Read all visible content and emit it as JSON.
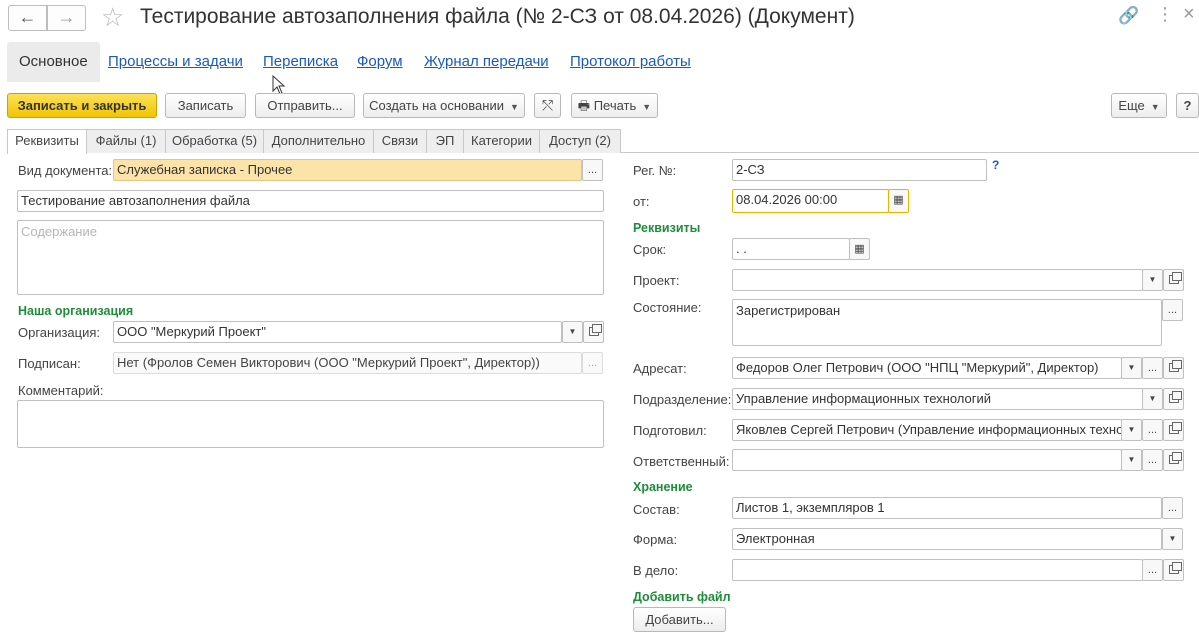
{
  "header": {
    "back_icon": "←",
    "forward_icon": "→",
    "star_icon": "☆",
    "title": "Тестирование автозаполнения файла (№ 2-СЗ от 08.04.2026) (Документ)",
    "link_icon": "🔗",
    "more_icon": "⋮",
    "close_icon": "×"
  },
  "sections": {
    "main": "Основное",
    "processes": "Процессы и задачи",
    "correspondence": "Переписка",
    "forum": "Форум",
    "transfer_log": "Журнал передачи",
    "work_log": "Протокол работы"
  },
  "toolbar": {
    "save_close": "Записать и закрыть",
    "save": "Записать",
    "send": "Отправить...",
    "create_based": "Создать на основании",
    "share_icon": "⤲",
    "print_icon": "🖶",
    "print": "Печать",
    "more": "Еще",
    "help": "?"
  },
  "tabs": {
    "requisites": "Реквизиты",
    "files": "Файлы (1)",
    "processing": "Обработка (5)",
    "additional": "Дополнительно",
    "links": "Связи",
    "ep": "ЭП",
    "categories": "Категории",
    "access": "Доступ (2)"
  },
  "left": {
    "doc_type_label": "Вид документа:",
    "doc_type_value": "Служебная записка - Прочее",
    "doc_title_value": "Тестирование автозаполнения файла",
    "content_placeholder": "Содержание",
    "org_group": "Наша организация",
    "org_label": "Организация:",
    "org_value": "ООО \"Меркурий Проект\"",
    "signed_label": "Подписан:",
    "signed_value": "Нет (Фролов Семен Викторович (ООО \"Меркурий Проект\", Директор))",
    "comment_label": "Комментарий:"
  },
  "right": {
    "reg_label": "Рег. №:",
    "reg_value": "2-СЗ",
    "help_q": "?",
    "from_label": "от:",
    "from_value": "08.04.2026 00:00",
    "req_group": "Реквизиты",
    "deadline_label": "Срок:",
    "deadline_value": " .  .",
    "project_label": "Проект:",
    "state_label": "Состояние:",
    "state_value": "Зарегистрирован",
    "addressee_label": "Адресат:",
    "addressee_value": "Федоров Олег Петрович (ООО \"НПЦ \"Меркурий\", Директор)",
    "dept_label": "Подразделение:",
    "dept_value": "Управление информационных технологий",
    "prepared_label": "Подготовил:",
    "prepared_value": "Яковлев Сергей Петрович (Управление информационных технологий)",
    "responsible_label": "Ответственный:",
    "storage_group": "Хранение",
    "composition_label": "Состав:",
    "composition_value": "Листов 1, экземпляров 1",
    "form_label": "Форма:",
    "form_value": "Электронная",
    "tocase_label": "В дело:",
    "addfile_group": "Добавить файл",
    "add_button": "Добавить..."
  },
  "glyphs": {
    "ellipsis": "...",
    "dropdown": "▼",
    "calendar": "▦"
  }
}
